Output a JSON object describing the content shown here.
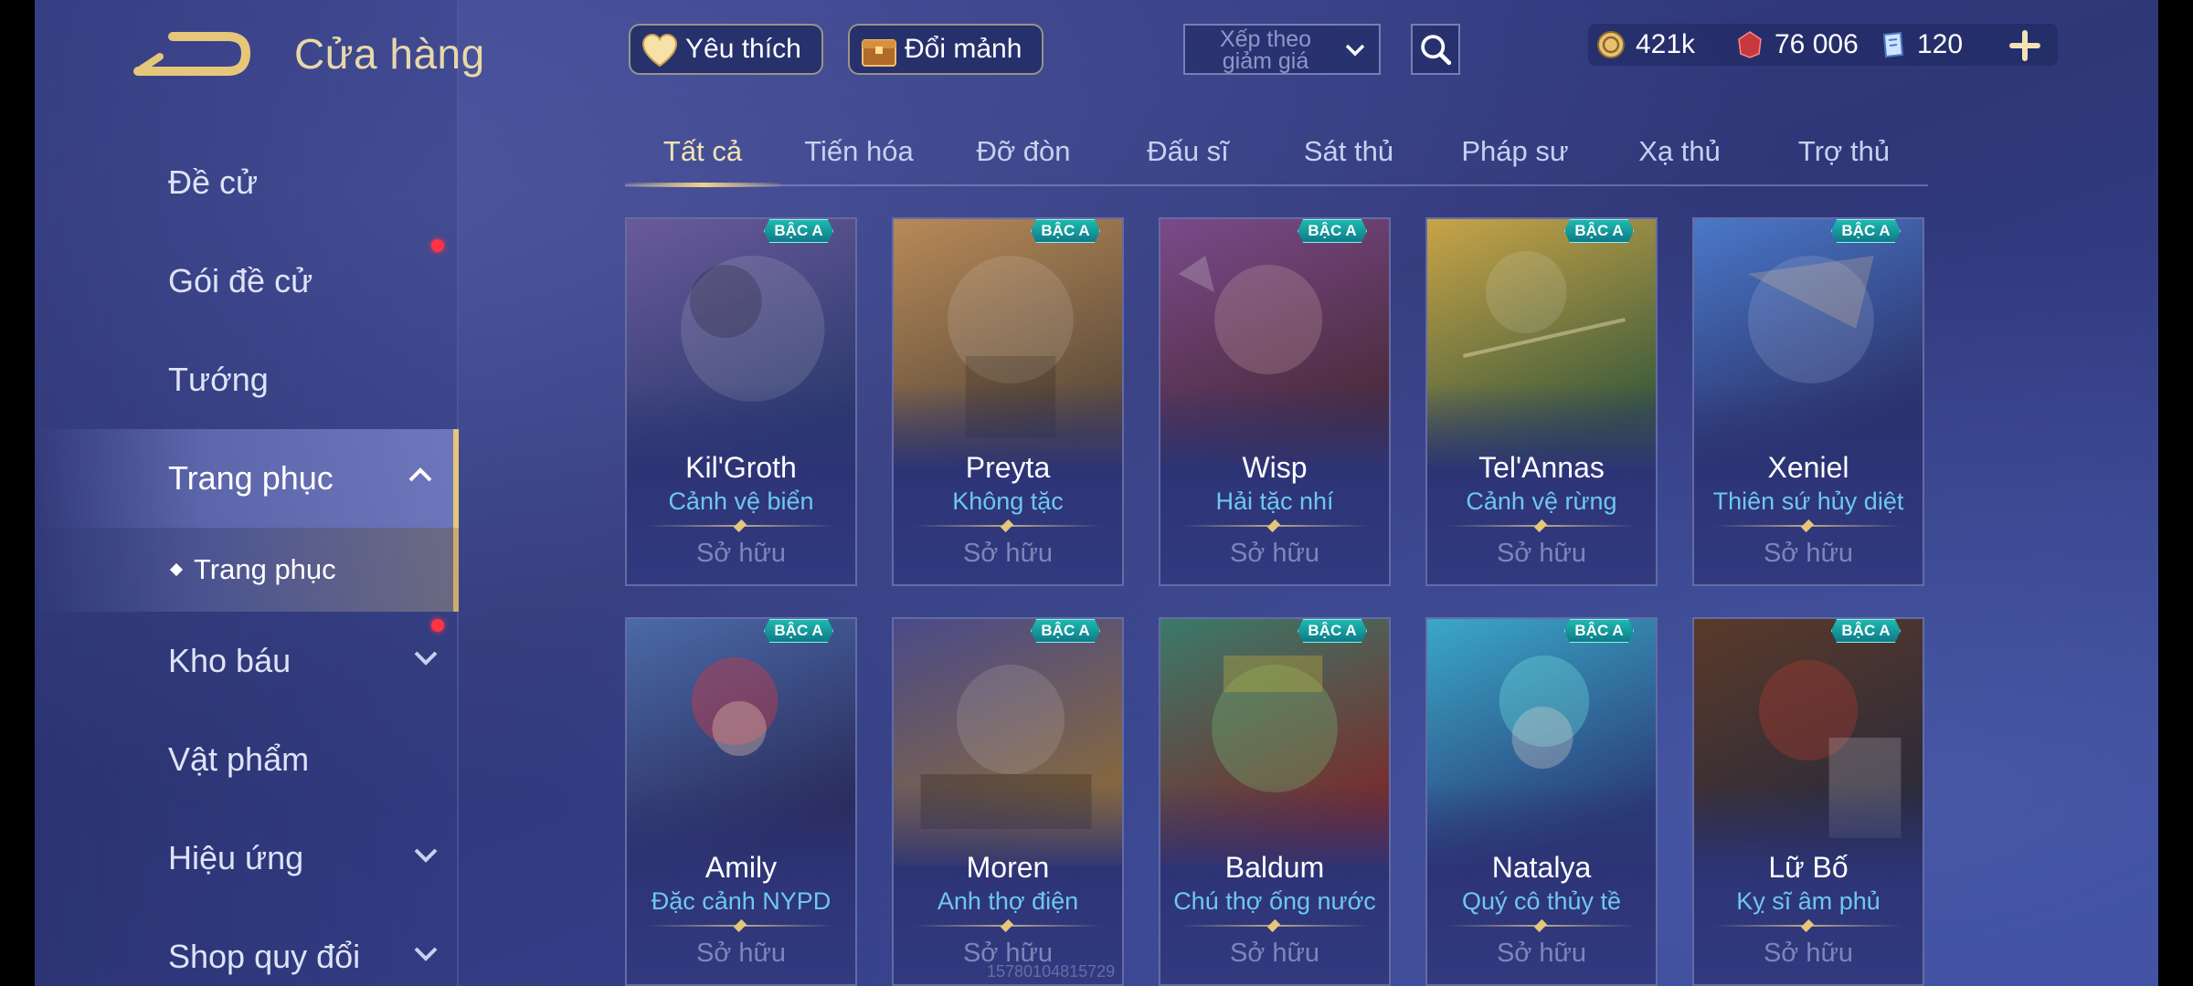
{
  "header": {
    "title": "Cửa hàng",
    "favorite_label": "Yêu thích",
    "exchange_label": "Đổi mảnh",
    "sort_label": "Xếp theo giảm giá",
    "currencies": [
      {
        "icon": "gold-coin-icon",
        "value": "421k"
      },
      {
        "icon": "red-gem-icon",
        "value": "76 006"
      },
      {
        "icon": "voucher-icon",
        "value": "120"
      }
    ]
  },
  "sidebar": {
    "items": [
      {
        "label": "Đề cử"
      },
      {
        "label": "Gói đề cử",
        "has_notification": true
      },
      {
        "label": "Tướng"
      },
      {
        "label": "Trang phục",
        "active": true,
        "expanded": true
      },
      {
        "label": "Kho báu",
        "has_notification": true
      },
      {
        "label": "Vật phẩm"
      },
      {
        "label": "Hiệu ứng"
      },
      {
        "label": "Shop quy đổi"
      }
    ],
    "sub_item": "Trang phục"
  },
  "tabs": [
    {
      "label": "Tất cả",
      "active": true
    },
    {
      "label": "Tiến hóa"
    },
    {
      "label": "Đỡ đòn"
    },
    {
      "label": "Đấu sĩ"
    },
    {
      "label": "Sát thủ"
    },
    {
      "label": "Pháp sư"
    },
    {
      "label": "Xạ thủ"
    },
    {
      "label": "Trợ thủ"
    }
  ],
  "cards": [
    {
      "badge": "BẬC A",
      "hero": "Kil'Groth",
      "skin": "Cảnh vệ biển",
      "status": "Sở hữu",
      "colors": [
        "#6a5a9a",
        "#2c3a6e"
      ]
    },
    {
      "badge": "BẬC A",
      "hero": "Preyta",
      "skin": "Không tặc",
      "status": "Sở hữu",
      "colors": [
        "#b88a58",
        "#5a4a3a"
      ]
    },
    {
      "badge": "BẬC A",
      "hero": "Wisp",
      "skin": "Hải tặc nhí",
      "status": "Sở hữu",
      "colors": [
        "#7a4a8a",
        "#4a2a3a"
      ]
    },
    {
      "badge": "BẬC A",
      "hero": "Tel'Annas",
      "skin": "Cảnh vệ rừng",
      "status": "Sở hữu",
      "colors": [
        "#c8a448",
        "#3a5a3a"
      ]
    },
    {
      "badge": "BẬC A",
      "hero": "Xeniel",
      "skin": "Thiên sứ hủy diệt",
      "status": "Sở hữu",
      "colors": [
        "#4a78c8",
        "#2a3068"
      ]
    },
    {
      "badge": "BẬC A",
      "hero": "Amily",
      "skin": "Đặc cảnh NYPD",
      "status": "Sở hữu",
      "colors": [
        "#4a6aa8",
        "#2a2a5a"
      ]
    },
    {
      "badge": "BẬC A",
      "hero": "Moren",
      "skin": "Anh thợ điện",
      "status": "Sở hữu",
      "colors": [
        "#4a4a8a",
        "#8a6a3a"
      ]
    },
    {
      "badge": "BẬC A",
      "hero": "Baldum",
      "skin": "Chú thợ ống nước",
      "status": "Sở hữu",
      "colors": [
        "#3a7a6a",
        "#7a2a2a"
      ]
    },
    {
      "badge": "BẬC A",
      "hero": "Natalya",
      "skin": "Quý cô thủy tề",
      "status": "Sở hữu",
      "colors": [
        "#3aa8c8",
        "#2a3a78"
      ]
    },
    {
      "badge": "BẬC A",
      "hero": "Lữ Bố",
      "skin": "Kỵ sĩ âm phủ",
      "status": "Sở hữu",
      "colors": [
        "#5a3a2a",
        "#2a2a3a"
      ]
    }
  ],
  "watermark": "15780104815729"
}
